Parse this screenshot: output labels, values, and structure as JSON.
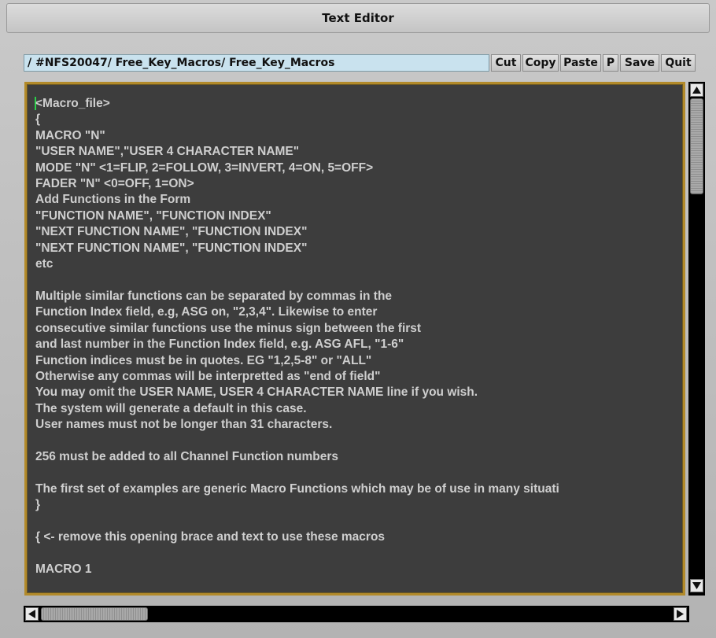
{
  "window": {
    "title": "Text Editor"
  },
  "toolbar": {
    "path": "/ #NFS20047/ Free_Key_Macros/ Free_Key_Macros",
    "cut_label": "Cut",
    "copy_label": "Copy",
    "paste_label": "Paste",
    "p_label": "P",
    "save_label": "Save",
    "quit_label": "Quit"
  },
  "editor": {
    "content": "<Macro_file>\n{\nMACRO \"N\"\n\"USER NAME\",\"USER 4 CHARACTER NAME\"\nMODE \"N\" <1=FLIP, 2=FOLLOW, 3=INVERT, 4=ON, 5=OFF>\nFADER \"N\" <0=OFF, 1=ON>\nAdd Functions in the Form\n\"FUNCTION NAME\", \"FUNCTION INDEX\"\n\"NEXT FUNCTION NAME\", \"FUNCTION INDEX\"\n\"NEXT FUNCTION NAME\", \"FUNCTION INDEX\"\netc\n\nMultiple similar functions can be separated by commas in the\nFunction Index field, e.g, ASG on, \"2,3,4\". Likewise to enter\nconsecutive similar functions use the minus sign between the first\nand last number in the Function Index field, e.g. ASG AFL, \"1-6\"\nFunction indices must be in quotes. EG \"1,2,5-8\" or \"ALL\"\nOtherwise any commas will be interpretted as \"end of field\"\nYou may omit the USER NAME, USER 4 CHARACTER NAME line if you wish.\nThe system will generate a default in this case.\nUser names must not be longer than 31 characters.\n\n256 must be added to all Channel Function numbers\n\nThe first set of examples are generic Macro Functions which may be of use in many situati\n}\n\n{ <- remove this opening brace and text to use these macros\n\nMACRO 1"
  },
  "colors": {
    "editor_bg": "#3d3d3d",
    "editor_border": "#b28a2a",
    "text": "#cfcfcf",
    "cursor": "#2ad14a",
    "path_bg": "#c9e2ee"
  },
  "icons": {
    "scroll_up": "triangle-up",
    "scroll_down": "triangle-down",
    "scroll_left": "triangle-left",
    "scroll_right": "triangle-right"
  }
}
